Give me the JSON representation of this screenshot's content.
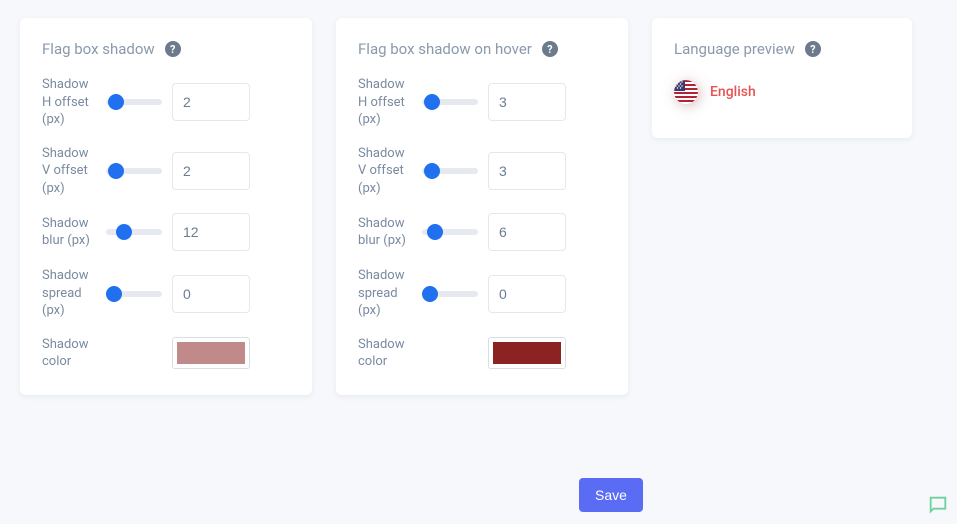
{
  "shadow_normal": {
    "title": "Flag box shadow",
    "h_offset_label": "Shadow H offset (px)",
    "h_offset_value": "2",
    "v_offset_label": "Shadow V offset (px)",
    "v_offset_value": "2",
    "blur_label": "Shadow blur (px)",
    "blur_value": "12",
    "spread_label": "Shadow spread (px)",
    "spread_value": "0",
    "color_label": "Shadow color",
    "color_value": "#c08a8a"
  },
  "shadow_hover": {
    "title": "Flag box shadow on hover",
    "h_offset_label": "Shadow H offset (px)",
    "h_offset_value": "3",
    "v_offset_label": "Shadow V offset (px)",
    "v_offset_value": "3",
    "blur_label": "Shadow blur (px)",
    "blur_value": "6",
    "spread_label": "Shadow spread (px)",
    "spread_value": "0",
    "color_label": "Shadow color",
    "color_value": "#8b2323"
  },
  "preview": {
    "title": "Language preview",
    "language": "English"
  },
  "save_label": "Save",
  "help_char": "?"
}
